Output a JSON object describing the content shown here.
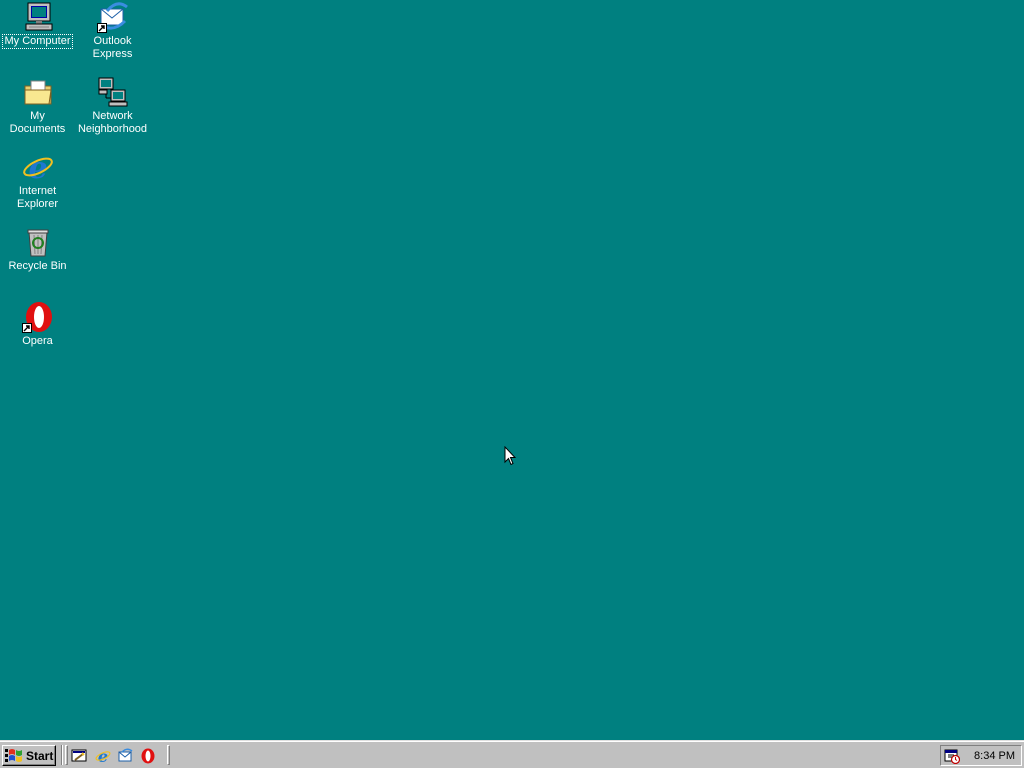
{
  "desktop": {
    "background_color": "#008080",
    "icons": [
      {
        "label": "My Computer",
        "icon": "computer-icon",
        "selected": true
      },
      {
        "label": "Outlook\nExpress",
        "icon": "outlook-express-icon"
      },
      {
        "label": "My Documents",
        "icon": "folder-icon"
      },
      {
        "label": "Network\nNeighborhood",
        "icon": "network-icon"
      },
      {
        "label": "Internet\nExplorer",
        "icon": "internet-explorer-icon"
      },
      {
        "label": "Recycle Bin",
        "icon": "recycle-bin-icon"
      },
      {
        "label": "Opera",
        "icon": "opera-icon"
      }
    ]
  },
  "taskbar": {
    "start_label": "Start",
    "quick_launch": [
      "show-desktop-icon",
      "internet-explorer-icon",
      "outlook-express-icon",
      "opera-icon"
    ],
    "tray": {
      "icons": [
        "scheduled-tasks-icon"
      ],
      "clock": "8:34 PM"
    }
  }
}
